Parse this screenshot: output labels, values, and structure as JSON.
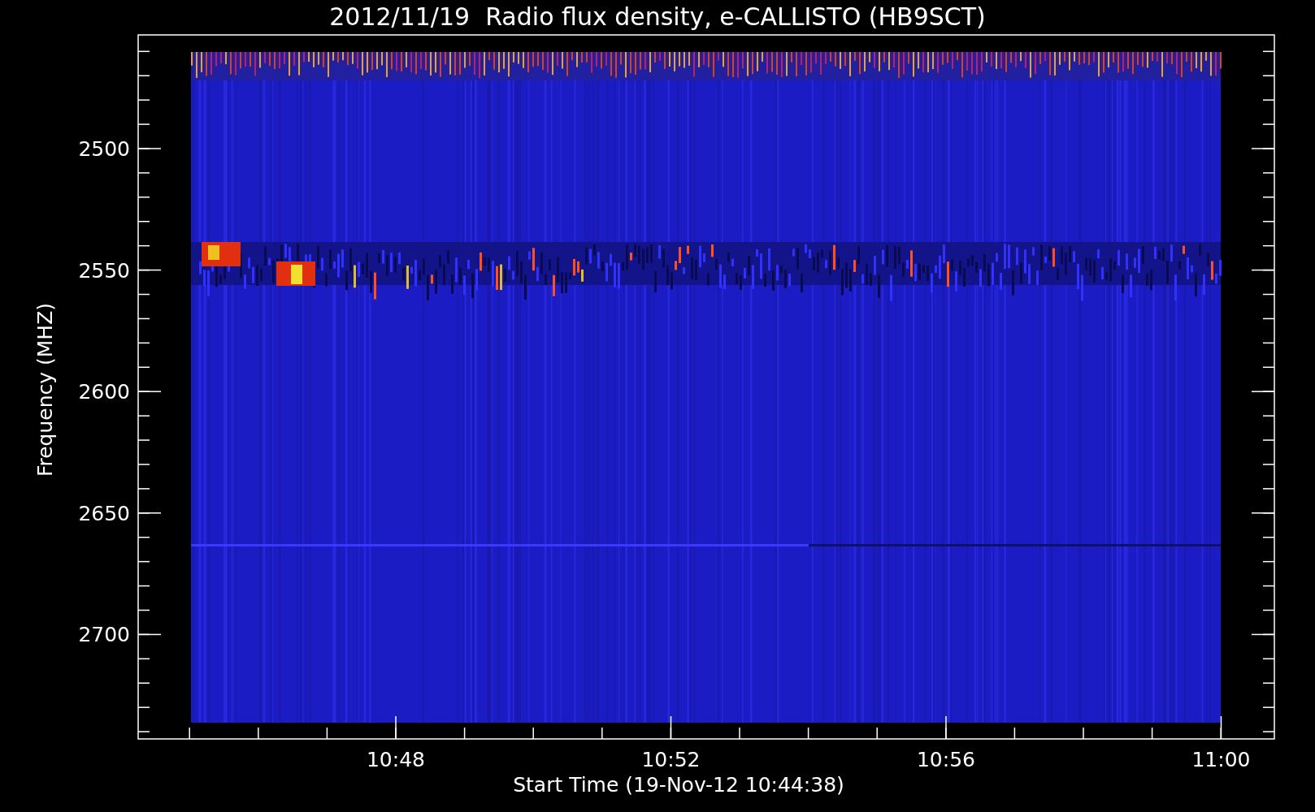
{
  "title": "2012/11/19  Radio flux density, e-CALLISTO (HB9SCT)",
  "yaxis": {
    "label": "Frequency (MHZ)",
    "ticks": [
      "2500",
      "2550",
      "2600",
      "2650",
      "2700"
    ]
  },
  "xaxis": {
    "label": "Start Time (19-Nov-12 10:44:38)",
    "ticks": [
      "10:48",
      "10:52",
      "10:56",
      "11:00"
    ]
  }
}
